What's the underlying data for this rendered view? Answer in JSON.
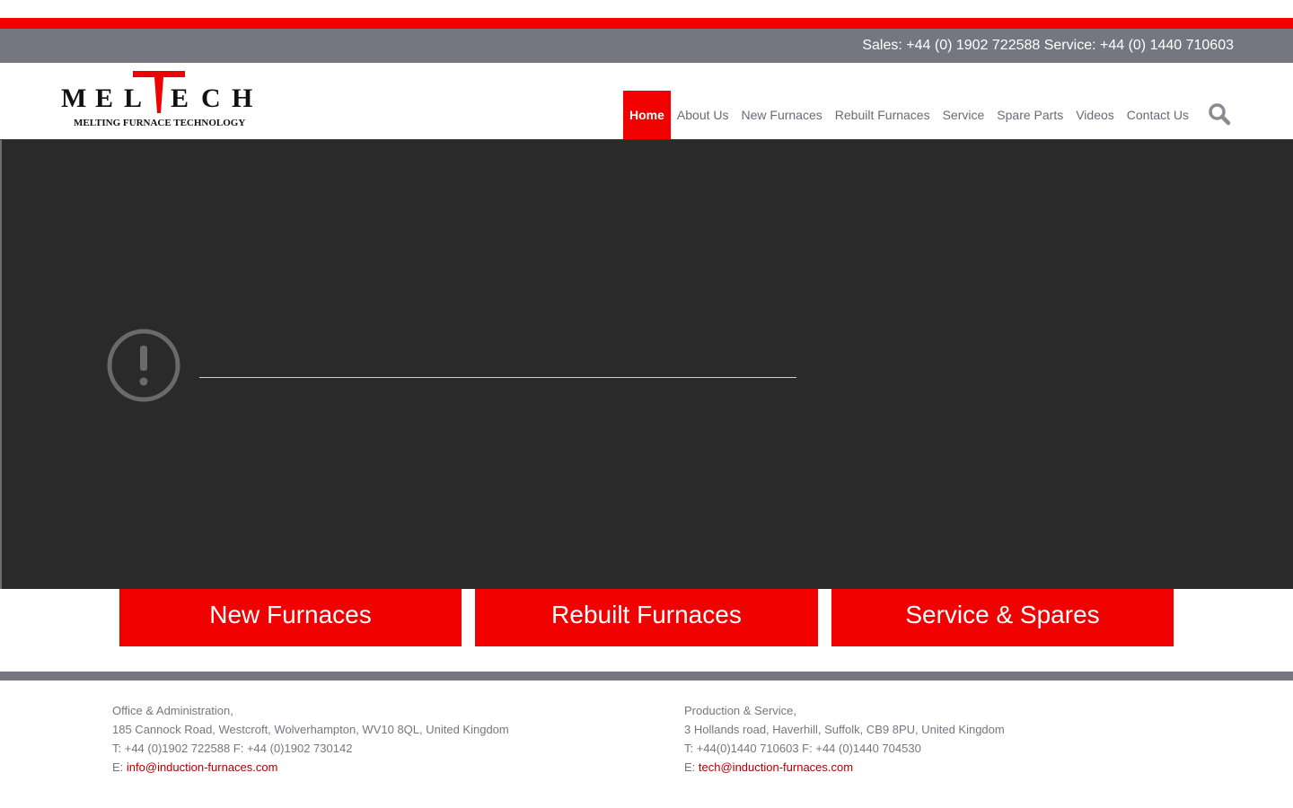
{
  "topbar": {
    "contact": "Sales: +44 (0) 1902 722588 Service: +44 (0) 1440 710603"
  },
  "logo": {
    "letters": [
      "M",
      "E",
      "L",
      "T",
      "E",
      "C",
      "H"
    ],
    "tagline": "MELTING FURNACE TECHNOLOGY"
  },
  "nav": {
    "items": [
      {
        "label": "Home",
        "active": true
      },
      {
        "label": "About Us"
      },
      {
        "label": "New Furnaces"
      },
      {
        "label": "Rebuilt Furnaces"
      },
      {
        "label": "Service"
      },
      {
        "label": "Spare Parts"
      },
      {
        "label": "Videos"
      },
      {
        "label": "Contact Us"
      }
    ]
  },
  "cta": {
    "new_furnaces": "New Furnaces",
    "rebuilt_furnaces": "Rebuilt Furnaces",
    "service_spares": "Service & Spares"
  },
  "footer": {
    "office": {
      "title": "Office & Administration,",
      "address": "185 Cannock Road, Westcroft, Wolverhampton, WV10 8QL, United Kingdom",
      "phone": "T: +44 (0)1902 722588 F: +44 (0)1902 730142",
      "email_prefix": "E: ",
      "email": "info@induction-furnaces.com"
    },
    "production": {
      "title": "Production & Service,",
      "address": "3 Hollands road, Haverhill, Suffolk, CB9 8PU, United Kingdom",
      "phone": "T: +44(0)1440 710603 F: +44 (0)1440 704530",
      "email_prefix": "E: ",
      "email": "tech@induction-furnaces.com"
    }
  },
  "colors": {
    "accent_red": "#f20000",
    "bar_grey": "#767680",
    "video_bg": "#2a2a2a",
    "link_red": "#b00000"
  }
}
